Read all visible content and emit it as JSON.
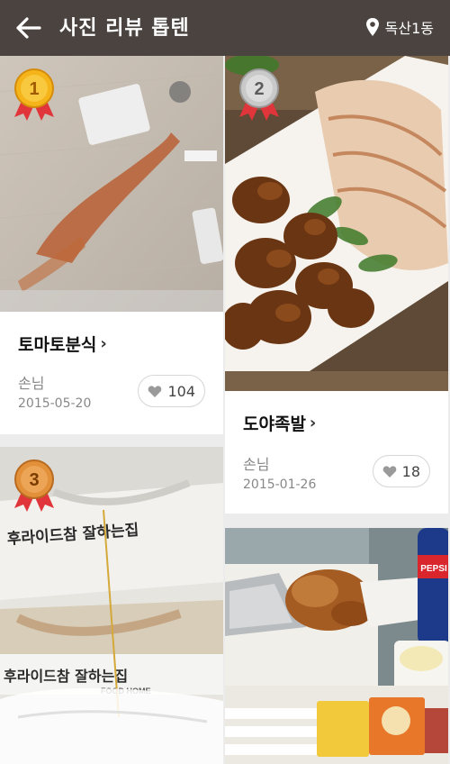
{
  "header": {
    "back_icon": "arrow-left-icon",
    "title": "사진 리뷰 톱텐",
    "location_icon": "map-pin-icon",
    "location": "독산1동"
  },
  "cards": [
    {
      "rank": "1",
      "medal": "gold",
      "shop": "토마토분식",
      "user": "손님",
      "date": "2015-05-20",
      "likes": "104"
    },
    {
      "rank": "2",
      "medal": "silver",
      "shop": "도야족발",
      "user": "손님",
      "date": "2015-01-26",
      "likes": "18"
    },
    {
      "rank": "3",
      "medal": "bronze",
      "shop": "",
      "user": "",
      "date": "",
      "likes": ""
    },
    {
      "rank": "",
      "medal": "",
      "shop": "",
      "user": "",
      "date": "",
      "likes": ""
    }
  ],
  "photo_texts": {
    "box_text_1": "후라이드참 잘하는집",
    "box_text_2": "후라이드참 잘하는집",
    "box_text_3": "FOOD HOME",
    "pepsi": "PEPSI"
  },
  "colors": {
    "header_bg": "#4a4340",
    "gold": "#f4b41a",
    "silver": "#c9c9c9",
    "bronze": "#e2903a",
    "ribbon": "#e0353a"
  }
}
